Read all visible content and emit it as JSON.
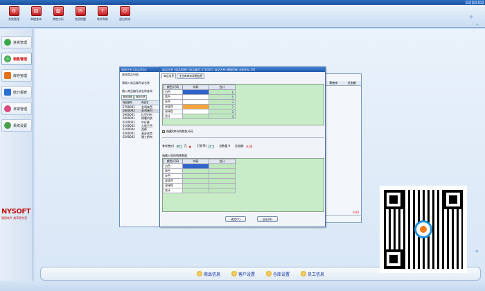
{
  "toolbar": {
    "items": [
      {
        "label": "系统管理",
        "icon": "system-icon"
      },
      {
        "label": "单据查询",
        "icon": "search-doc-icon"
      },
      {
        "label": "销售分析",
        "icon": "chart-icon"
      },
      {
        "label": "信息提醒",
        "icon": "mail-icon"
      },
      {
        "label": "软件帮助",
        "icon": "help-icon"
      },
      {
        "label": "退出系统",
        "icon": "exit-icon"
      }
    ]
  },
  "sidebar": {
    "items": [
      {
        "label": "进货管理",
        "color": "#3aa84a"
      },
      {
        "label": "销售管理",
        "color": "#d11a1a"
      },
      {
        "label": "库存管理",
        "color": "#e2731a"
      },
      {
        "label": "统计报表",
        "color": "#2a6fd1"
      },
      {
        "label": "日常管理",
        "color": "#d84a7a"
      },
      {
        "label": "系统设置",
        "color": "#4aa04a"
      }
    ],
    "logo_main": "NYSOFT",
    "logo_sub": "管理软件 美萍是专家"
  },
  "back_window": {
    "title": "销售开单 [商品资料]",
    "query_label": "查询商品列表",
    "prompt1": "请输入商品编号或名称",
    "prompt2": "输入商品编号或名称查询",
    "tabs": [
      "商品搜索",
      "商品列表"
    ],
    "headers": [
      "商品编号",
      "商品名"
    ],
    "rows": [
      [
        "5700001",
        "金利来西"
      ],
      [
        "5800002",
        "金利来衬"
      ],
      [
        "5900001",
        "红豆衬衫"
      ],
      [
        "6000001",
        "保暖内衣"
      ],
      [
        "6100001",
        "牛仔裤"
      ],
      [
        "6100002",
        "九牧王西"
      ],
      [
        "6100004",
        "西裤"
      ],
      [
        "6200001",
        "真丝夹克"
      ],
      [
        "6200002",
        "雅士帆布"
      ]
    ]
  },
  "right_window": {
    "headers": [
      "零售库",
      "总金额"
    ],
    "total": "0.00"
  },
  "dialog": {
    "title": "商品信息 [商品销售] [商品编号:5700001 商品名称:横幅西服 当前库存:29]",
    "tabs": [
      "商品信息",
      "主仓库库存详细信息"
    ],
    "grid1": {
      "headers": [
        "颜色/尺码",
        "均码",
        "合计"
      ],
      "rows": [
        {
          "label": "白色",
          "total": "1"
        },
        {
          "label": "黑色",
          "total": "5"
        },
        {
          "label": "灰色",
          "total": "3"
        },
        {
          "label": "深蓝色",
          "total": "7"
        },
        {
          "label": "深绿色",
          "total": "3"
        },
        {
          "label": "合计",
          "total": "3"
        }
      ]
    },
    "hide_zero_label": "隐藏0库存的颜色尺码",
    "price_label": "参考售价(",
    "price_value": "10",
    "price_unit": "元",
    "discount_label": "打折率(",
    "discount_value": "1",
    "qty_label": "总数量 0",
    "amount_label": "总金额:",
    "amount_value": "0.00",
    "grid2_label": "请输入您的销售数量",
    "grid2": {
      "headers": [
        "颜色/尺码",
        "均码",
        "合计"
      ],
      "rows": [
        {
          "label": "白色"
        },
        {
          "label": "黑色"
        },
        {
          "label": "灰色"
        },
        {
          "label": "深蓝色"
        },
        {
          "label": "深绿色"
        },
        {
          "label": "合计"
        }
      ]
    },
    "ok_label": "确定(Y)",
    "cancel_label": "退出(N)"
  },
  "bottom_nav": {
    "items": [
      "商品信息",
      "客户设置",
      "仓库设置",
      "员工信息"
    ]
  }
}
